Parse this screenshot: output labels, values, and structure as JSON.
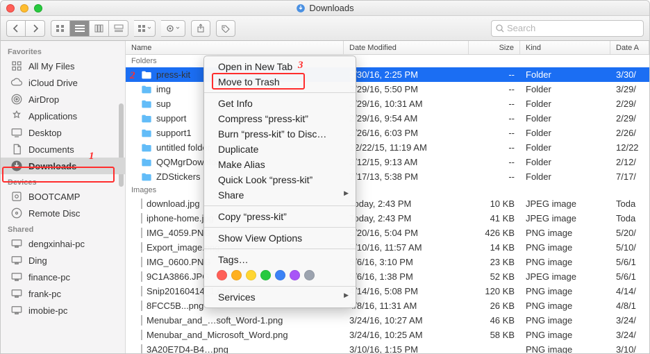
{
  "window": {
    "title": "Downloads"
  },
  "search": {
    "placeholder": "Search"
  },
  "sidebar": {
    "sections": [
      {
        "header": "Favorites",
        "items": [
          {
            "label": "All My Files",
            "icon": "all"
          },
          {
            "label": "iCloud Drive",
            "icon": "cloud"
          },
          {
            "label": "AirDrop",
            "icon": "airdrop"
          },
          {
            "label": "Applications",
            "icon": "apps"
          },
          {
            "label": "Desktop",
            "icon": "desktop"
          },
          {
            "label": "Documents",
            "icon": "docs"
          },
          {
            "label": "Downloads",
            "icon": "downloads",
            "selected": true
          }
        ]
      },
      {
        "header": "Devices",
        "items": [
          {
            "label": "BOOTCAMP",
            "icon": "disk"
          },
          {
            "label": "Remote Disc",
            "icon": "disc"
          }
        ]
      },
      {
        "header": "Shared",
        "items": [
          {
            "label": "dengxinhai-pc",
            "icon": "pc"
          },
          {
            "label": "Ding",
            "icon": "pc"
          },
          {
            "label": "finance-pc",
            "icon": "pc"
          },
          {
            "label": "frank-pc",
            "icon": "pc"
          },
          {
            "label": "imobie-pc",
            "icon": "pc"
          }
        ]
      }
    ]
  },
  "columns": {
    "name": "Name",
    "date": "Date Modified",
    "size": "Size",
    "kind": "Kind",
    "datea": "Date A"
  },
  "groups": [
    {
      "header": "Folders",
      "rows": [
        {
          "type": "folder",
          "name": "press-kit",
          "date": "3/30/16, 2:25 PM",
          "size": "--",
          "kind": "Folder",
          "datea": "3/30/",
          "sel": true
        },
        {
          "type": "folder",
          "name": "img",
          "date": "3/29/16, 5:50 PM",
          "size": "--",
          "kind": "Folder",
          "datea": "3/29/"
        },
        {
          "type": "folder",
          "name": "sup",
          "date": "2/29/16, 10:31 AM",
          "size": "--",
          "kind": "Folder",
          "datea": "2/29/"
        },
        {
          "type": "folder",
          "name": "support",
          "date": "2/29/16, 9:54 AM",
          "size": "--",
          "kind": "Folder",
          "datea": "2/29/"
        },
        {
          "type": "folder",
          "name": "support1",
          "date": "2/26/16, 6:03 PM",
          "size": "--",
          "kind": "Folder",
          "datea": "2/26/"
        },
        {
          "type": "folder",
          "name": "untitled folder",
          "date": "12/22/15, 11:19 AM",
          "size": "--",
          "kind": "Folder",
          "datea": "12/22"
        },
        {
          "type": "folder",
          "name": "QQMgrDownload",
          "date": "2/12/15, 9:13 AM",
          "size": "--",
          "kind": "Folder",
          "datea": "2/12/"
        },
        {
          "type": "folder",
          "name": "ZDStickers",
          "date": "7/17/13, 5:38 PM",
          "size": "--",
          "kind": "Folder",
          "datea": "7/17/"
        }
      ]
    },
    {
      "header": "Images",
      "rows": [
        {
          "type": "img",
          "name": "download.jpg",
          "date": "Today, 2:43 PM",
          "size": "10 KB",
          "kind": "JPEG image",
          "datea": "Toda"
        },
        {
          "type": "img",
          "name": "iphone-home.jpg",
          "date": "Today, 2:43 PM",
          "size": "41 KB",
          "kind": "JPEG image",
          "datea": "Toda"
        },
        {
          "type": "img",
          "name": "IMG_4059.PNG",
          "date": "5/20/16, 5:04 PM",
          "size": "426 KB",
          "kind": "PNG image",
          "datea": "5/20/"
        },
        {
          "type": "img",
          "name": "Export_image.png",
          "date": "5/10/16, 11:57 AM",
          "size": "14 KB",
          "kind": "PNG image",
          "datea": "5/10/"
        },
        {
          "type": "img",
          "name": "IMG_0600.PNG",
          "date": "5/6/16, 3:10 PM",
          "size": "23 KB",
          "kind": "PNG image",
          "datea": "5/6/1"
        },
        {
          "type": "img",
          "name": "9C1A3866.JPG",
          "date": "5/6/16, 1:38 PM",
          "size": "52 KB",
          "kind": "JPEG image",
          "datea": "5/6/1"
        },
        {
          "type": "img",
          "name": "Snip20160414_1.png",
          "date": "4/14/16, 5:08 PM",
          "size": "120 KB",
          "kind": "PNG image",
          "datea": "4/14/"
        },
        {
          "type": "img",
          "name": "8FCC5B...png",
          "date": "4/8/16, 11:31 AM",
          "size": "26 KB",
          "kind": "PNG image",
          "datea": "4/8/1"
        },
        {
          "type": "img",
          "name": "Menubar_and_…soft_Word-1.png",
          "date": "3/24/16, 10:27 AM",
          "size": "46 KB",
          "kind": "PNG image",
          "datea": "3/24/"
        },
        {
          "type": "img",
          "name": "Menubar_and_Microsoft_Word.png",
          "date": "3/24/16, 10:25 AM",
          "size": "58 KB",
          "kind": "PNG image",
          "datea": "3/24/"
        },
        {
          "type": "img",
          "name": "3A20E7D4-B4…png",
          "date": "3/10/16, 1:15 PM",
          "size": "",
          "kind": "PNG image",
          "datea": "3/10/"
        }
      ]
    }
  ],
  "context_menu": {
    "items": [
      {
        "label": "Open in New Tab"
      },
      {
        "label": "Move to Trash",
        "highlight": true
      },
      {
        "sep": true
      },
      {
        "label": "Get Info"
      },
      {
        "label": "Compress “press-kit”"
      },
      {
        "label": "Burn “press-kit” to Disc…"
      },
      {
        "label": "Duplicate"
      },
      {
        "label": "Make Alias"
      },
      {
        "label": "Quick Look “press-kit”"
      },
      {
        "label": "Share",
        "sub": true
      },
      {
        "sep": true
      },
      {
        "label": "Copy “press-kit”"
      },
      {
        "sep": true
      },
      {
        "label": "Show View Options"
      },
      {
        "sep": true
      },
      {
        "label": "Tags…"
      },
      {
        "tags": [
          "#ff5f57",
          "#ffb01f",
          "#ffd633",
          "#27c93f",
          "#3b82f6",
          "#a855f7",
          "#9ca3af"
        ]
      },
      {
        "sep": true
      },
      {
        "label": "Services",
        "sub": true
      }
    ]
  },
  "annotations": {
    "1": "1",
    "2": "2",
    "3": "3"
  }
}
